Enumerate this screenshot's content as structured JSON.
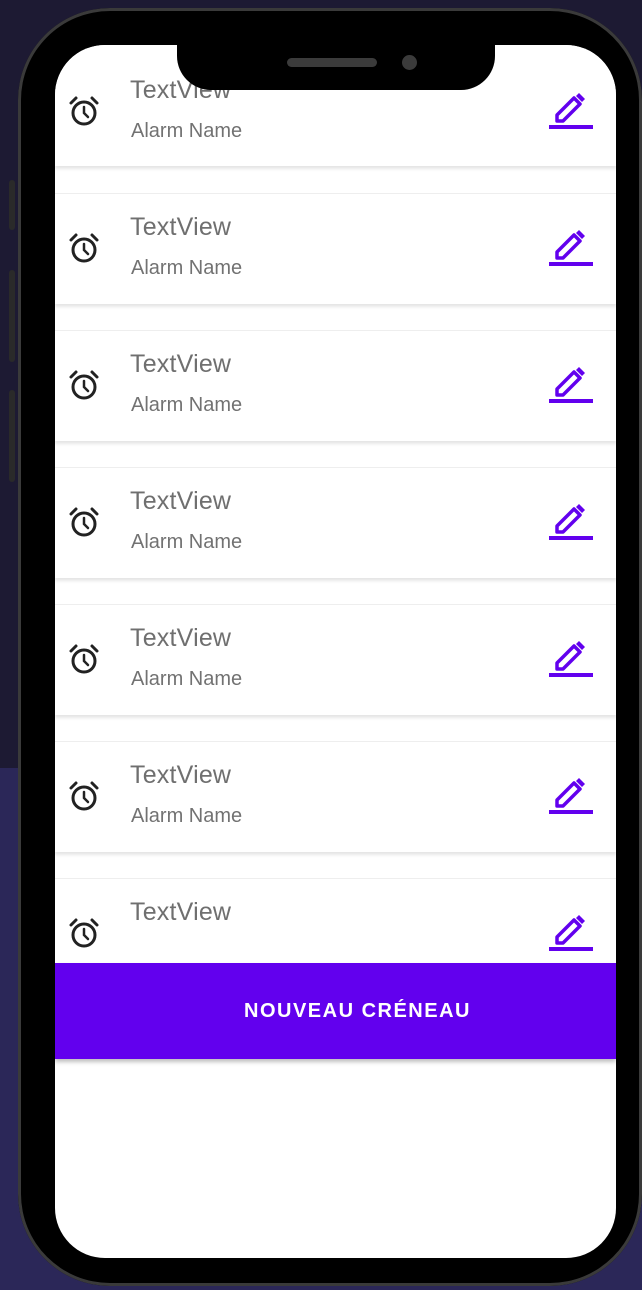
{
  "colors": {
    "accent": "#6200ee",
    "title": "#6f6f6f",
    "subtitle": "#727272"
  },
  "alarms": [
    {
      "title": "TextView",
      "name": "Alarm Name"
    },
    {
      "title": "TextView",
      "name": "Alarm Name"
    },
    {
      "title": "TextView",
      "name": "Alarm Name"
    },
    {
      "title": "TextView",
      "name": "Alarm Name"
    },
    {
      "title": "TextView",
      "name": "Alarm Name"
    },
    {
      "title": "TextView",
      "name": "Alarm Name"
    },
    {
      "title": "TextView",
      "name": ""
    }
  ],
  "icons": {
    "leading": "alarm-clock-icon",
    "trailing": "pencil-edit-icon"
  },
  "new_slot_button": "NOUVEAU CRÉNEAU"
}
